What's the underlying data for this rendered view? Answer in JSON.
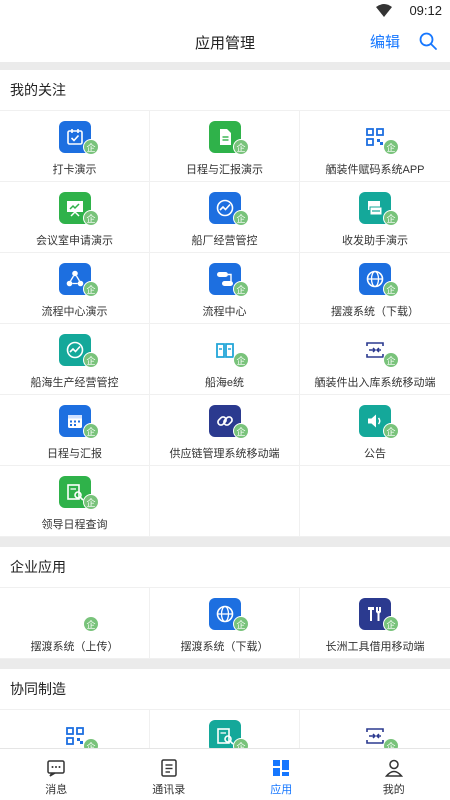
{
  "status_bar": {
    "time": "09:12"
  },
  "header": {
    "title": "应用管理",
    "edit_label": "编辑"
  },
  "badge_text": "企",
  "colors": {
    "accent": "#1677ff",
    "badge": "#79c37b",
    "blue": "#1d6fe0",
    "green": "#2fb24a",
    "teal": "#14a89a",
    "navy": "#2b3a8f"
  },
  "sections": [
    {
      "title": "我的关注",
      "apps": [
        {
          "label": "打卡演示",
          "icon": "calendar-check-icon",
          "color": "#1d6fe0"
        },
        {
          "label": "日程与汇报演示",
          "icon": "document-icon",
          "color": "#2fb24a"
        },
        {
          "label": "舾装件赋码系统APP",
          "icon": "qr-code-icon",
          "color": ""
        },
        {
          "label": "会议室申请演示",
          "icon": "presentation-icon",
          "color": "#2fb24a"
        },
        {
          "label": "船厂经营管控",
          "icon": "trend-chart-icon",
          "color": "#1d6fe0"
        },
        {
          "label": "收发助手演示",
          "icon": "inbox-icon",
          "color": "#14a89a"
        },
        {
          "label": "流程中心演示",
          "icon": "workflow-icon",
          "color": "#1d6fe0"
        },
        {
          "label": "流程中心",
          "icon": "flow-icon",
          "color": "#1d6fe0"
        },
        {
          "label": "摆渡系统（下载）",
          "icon": "globe-icon",
          "color": "#1d6fe0"
        },
        {
          "label": "船海生产经营管控",
          "icon": "trend-chart-icon",
          "color": "#14a89a"
        },
        {
          "label": "船海e统",
          "icon": "book-icon",
          "color": ""
        },
        {
          "label": "舾装件出入库系统移动端",
          "icon": "transfer-icon",
          "color": ""
        },
        {
          "label": "日程与汇报",
          "icon": "calendar-icon",
          "color": "#1d6fe0"
        },
        {
          "label": "供应链管理系统移动端",
          "icon": "link-icon",
          "color": "#2b3a8f"
        },
        {
          "label": "公告",
          "icon": "speaker-icon",
          "color": "#14a89a"
        },
        {
          "label": "领导日程查询",
          "icon": "search-doc-icon",
          "color": "#2fb24a"
        }
      ]
    },
    {
      "title": "企业应用",
      "apps": [
        {
          "label": "摆渡系统（上传）",
          "icon": "globe-icon",
          "color": ""
        },
        {
          "label": "摆渡系统（下载）",
          "icon": "globe-icon",
          "color": "#1d6fe0"
        },
        {
          "label": "长洲工具借用移动端",
          "icon": "tools-icon",
          "color": "#2b3a8f"
        }
      ]
    },
    {
      "title": "协同制造",
      "apps": [
        {
          "label": "",
          "icon": "qr-code-icon",
          "color": ""
        },
        {
          "label": "",
          "icon": "search-doc-icon",
          "color": "#14a89a"
        },
        {
          "label": "",
          "icon": "transfer-icon",
          "color": ""
        }
      ]
    }
  ],
  "bottom_nav": [
    {
      "label": "消息",
      "icon": "message-icon",
      "active": false
    },
    {
      "label": "通讯录",
      "icon": "contacts-icon",
      "active": false
    },
    {
      "label": "应用",
      "icon": "apps-icon",
      "active": true
    },
    {
      "label": "我的",
      "icon": "profile-icon",
      "active": false
    }
  ]
}
